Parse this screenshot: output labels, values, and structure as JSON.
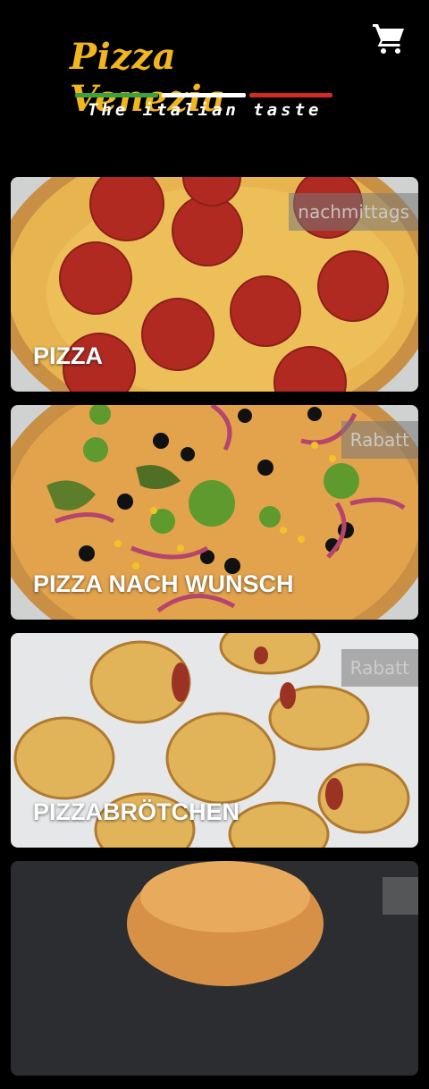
{
  "header": {
    "logo_title": "Pizza Venezia",
    "logo_subtitle": "The italian taste",
    "cart_icon": "cart-icon",
    "colors": {
      "brand": "#f0b51f",
      "flag_green": "#3ca23c",
      "flag_white": "#ffffff",
      "flag_red": "#d32a1f"
    }
  },
  "categories": [
    {
      "label": "PIZZA",
      "badge": "nachmittags",
      "image": "pepperoni-pizza"
    },
    {
      "label": "PIZZA NACH WUNSCH",
      "badge": "Rabatt",
      "image": "vegetable-pizza"
    },
    {
      "label": "PIZZABRÖTCHEN",
      "badge": "Rabatt",
      "image": "pizza-rolls"
    },
    {
      "label": "",
      "badge": "",
      "image": "burger"
    }
  ]
}
